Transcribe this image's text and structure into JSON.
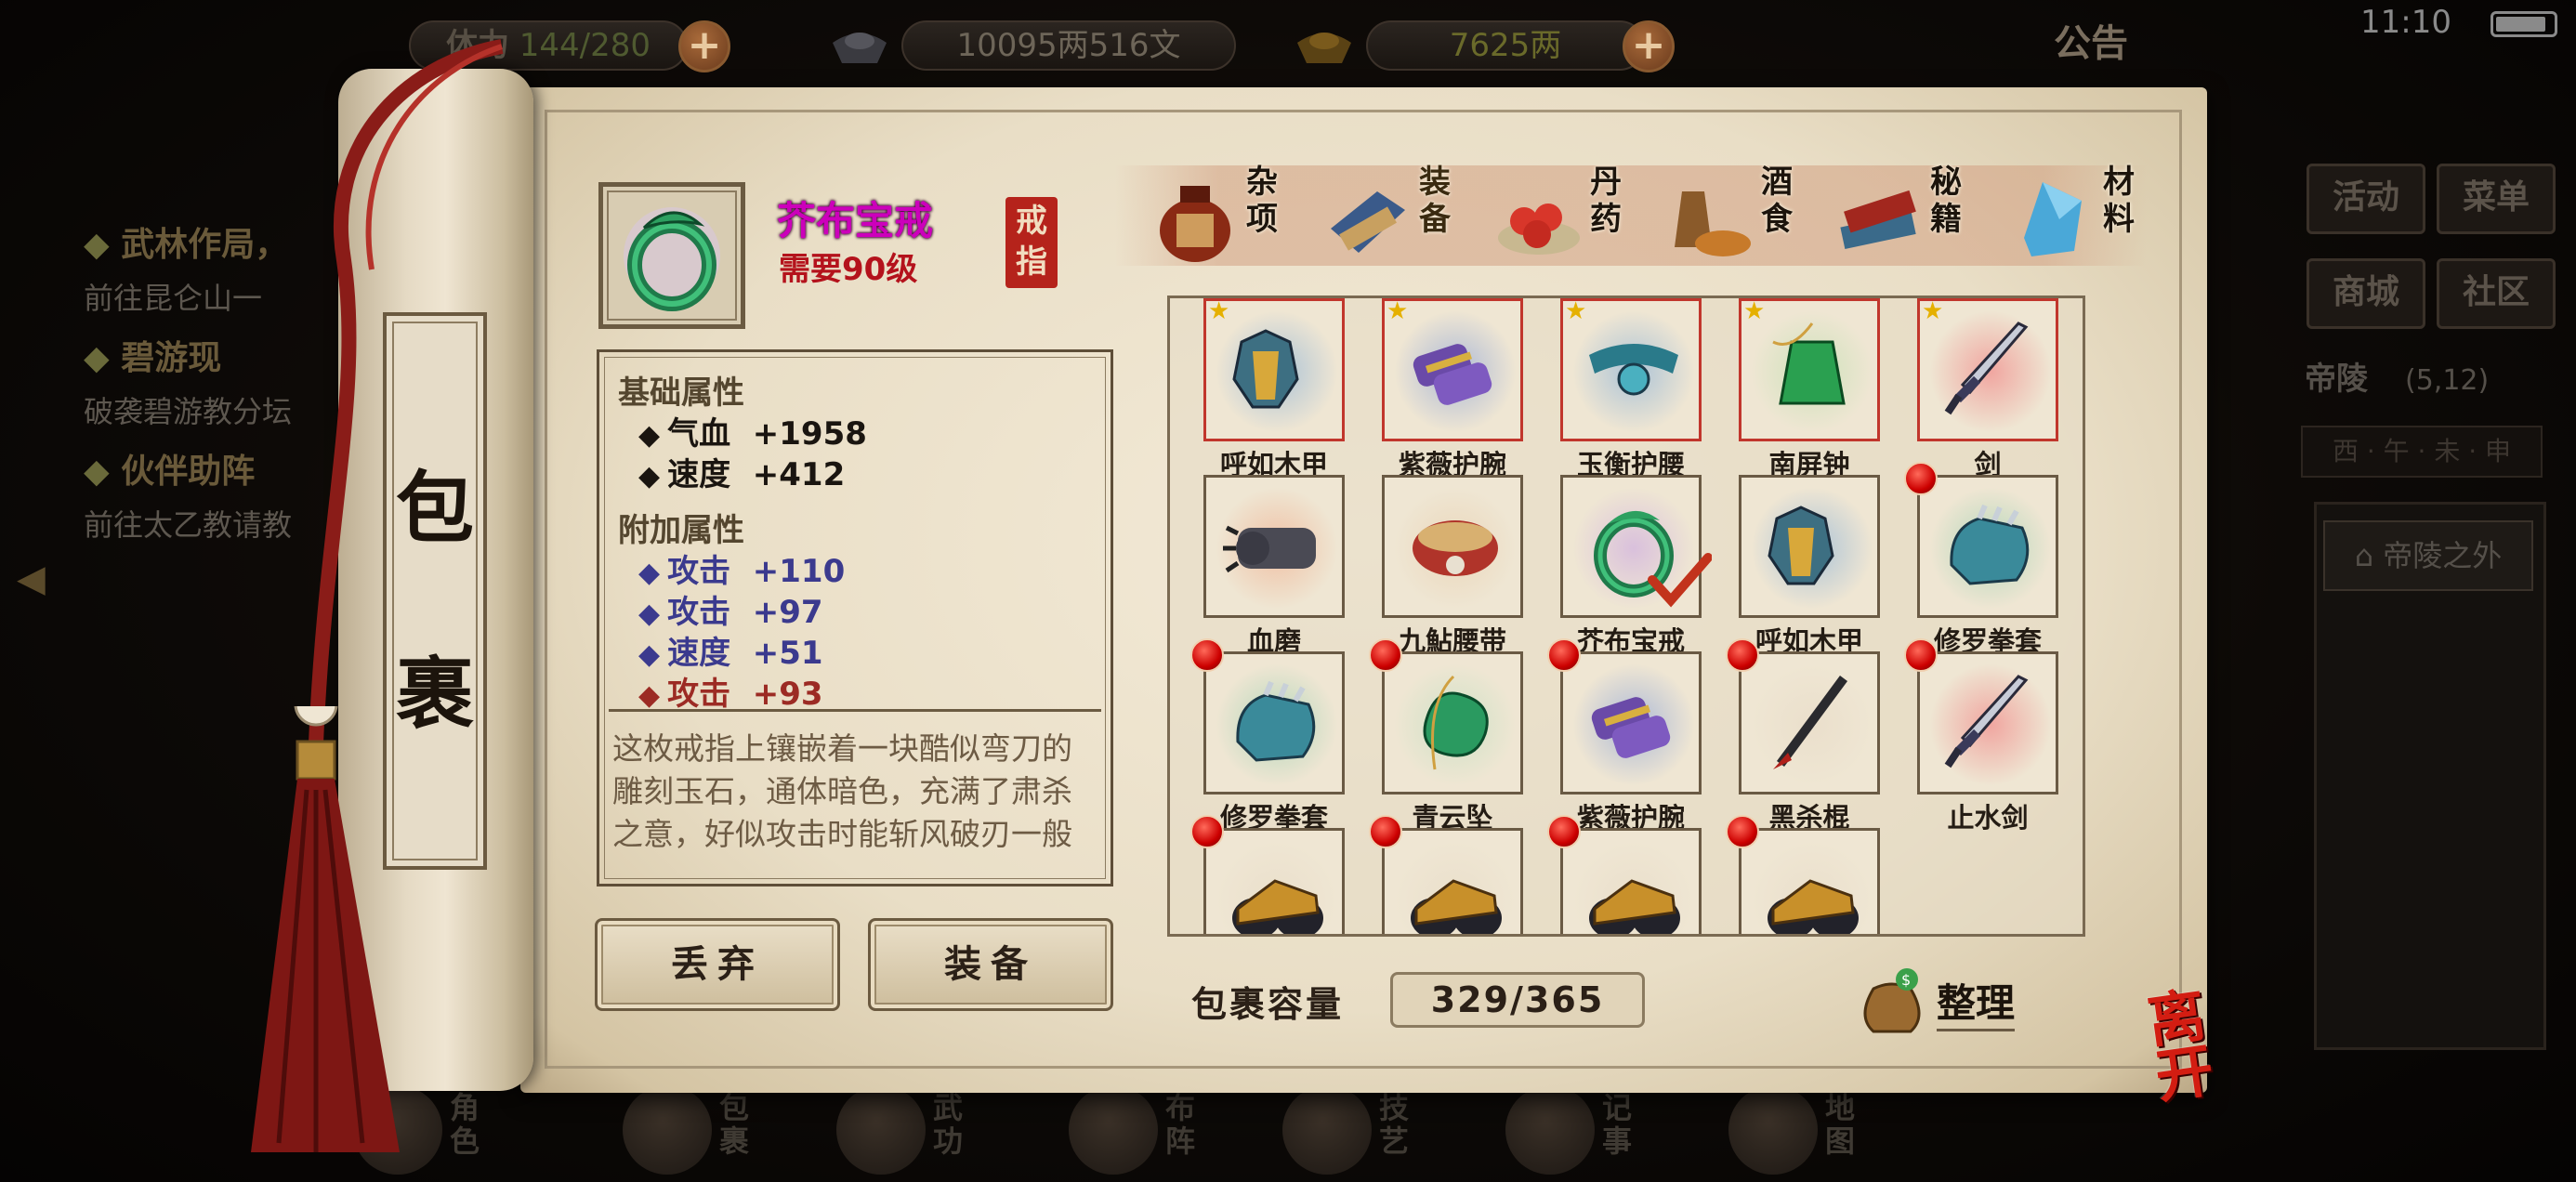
{
  "topbar": {
    "stamina_label": "体力",
    "stamina_value": "144/280",
    "silver_value": "10095两516文",
    "gold_value": "7625两",
    "notice": "公告",
    "clock": "11:10",
    "plus": "+"
  },
  "quests": [
    {
      "title": "武林作局，",
      "desc": "前往昆仑山一"
    },
    {
      "title": "碧游现",
      "desc": "破袭碧游教分坛"
    },
    {
      "title": "伙伴助阵",
      "desc": "前往太乙教请教"
    }
  ],
  "right_menu": {
    "activity": "活动",
    "menu": "菜单",
    "shop": "商城",
    "community": "社区",
    "location": "帝陵",
    "coords": "(5,12)",
    "compass": "西 · 午 · 未 · 申",
    "outside": "帝陵之外"
  },
  "bottom_nav": [
    {
      "label": "角色"
    },
    {
      "label": "包裹"
    },
    {
      "label": "武功"
    },
    {
      "label": "布阵"
    },
    {
      "label": "技艺"
    },
    {
      "label": "记事"
    },
    {
      "label": "地图"
    }
  ],
  "scroll": {
    "title_1": "包",
    "title_2": "裹"
  },
  "selected": {
    "name": "芥布宝戒",
    "level_req": "需要90级",
    "seal_1": "戒",
    "seal_2": "指",
    "base_title": "基础属性",
    "base": [
      {
        "name": "气血",
        "value": "+1958"
      },
      {
        "name": "速度",
        "value": "+412"
      }
    ],
    "extra_title": "附加属性",
    "extra": [
      {
        "name": "攻击",
        "value": "+110",
        "color": "blue"
      },
      {
        "name": "攻击",
        "value": "+97",
        "color": "blue"
      },
      {
        "name": "速度",
        "value": "+51",
        "color": "blue"
      },
      {
        "name": "攻击",
        "value": "+93",
        "color": "red"
      }
    ],
    "description": "这枚戒指上镶嵌着一块酷似弯刀的雕刻玉石，通体暗色，充满了肃杀之意，好似攻击时能斩风破刃一般"
  },
  "actions": {
    "discard": "丢弃",
    "equip": "装备"
  },
  "tabs": [
    {
      "label": "杂项",
      "icon": "jar-icon"
    },
    {
      "label": "装备",
      "icon": "equipment-icon",
      "active": true
    },
    {
      "label": "丹药",
      "icon": "pill-icon"
    },
    {
      "label": "酒食",
      "icon": "food-icon"
    },
    {
      "label": "秘籍",
      "icon": "book-icon"
    },
    {
      "label": "材料",
      "icon": "crystal-icon"
    }
  ],
  "inventory": [
    {
      "name": "呼如木甲",
      "equipped": true,
      "icon": "armor-icon"
    },
    {
      "name": "紫薇护腕",
      "equipped": true,
      "icon": "bracer-icon"
    },
    {
      "name": "玉衡护腰",
      "equipped": true,
      "icon": "belt-icon"
    },
    {
      "name": "南屏钟",
      "equipped": true,
      "icon": "bell-icon"
    },
    {
      "name": "剑",
      "equipped": true,
      "icon": "sword-icon"
    },
    {
      "name": "血磨",
      "icon": "gauntlet-icon"
    },
    {
      "name": "九鮎腰带",
      "icon": "waistband-icon"
    },
    {
      "name": "芥布宝戒",
      "selected": true,
      "icon": "ring-icon"
    },
    {
      "name": "呼如木甲",
      "icon": "armor-icon"
    },
    {
      "name": "修罗拳套",
      "new": true,
      "icon": "fist-icon"
    },
    {
      "name": "修罗拳套",
      "new": true,
      "icon": "fist-icon"
    },
    {
      "name": "青云坠",
      "new": true,
      "icon": "pendant-icon"
    },
    {
      "name": "紫薇护腕",
      "new": true,
      "icon": "bracer-icon"
    },
    {
      "name": "黑杀棍",
      "new": true,
      "icon": "staff-icon"
    },
    {
      "name": "止水剑",
      "new": true,
      "icon": "sword-icon"
    },
    {
      "name": "",
      "new": true,
      "icon": "bracer-gold-icon"
    },
    {
      "name": "",
      "new": true,
      "icon": "bracer-gold-icon"
    },
    {
      "name": "",
      "new": true,
      "icon": "bracer-gold-icon"
    },
    {
      "name": "",
      "new": true,
      "icon": "bracer-gold-icon"
    }
  ],
  "capacity": {
    "label": "包裹容量",
    "value": "329/365"
  },
  "sort_label": "整理",
  "leave_label": "离开",
  "colors": {
    "name_purple": "#cc00bb",
    "level_red": "#b4121c",
    "equipped_border": "#c1362c",
    "stat_blue": "#3b3a8e",
    "stat_red": "#9c2b24"
  }
}
